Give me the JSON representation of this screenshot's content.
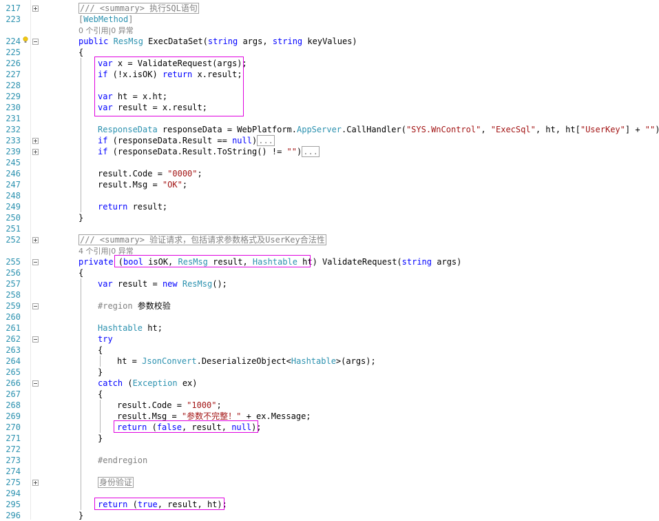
{
  "editor": {
    "lines": [
      {
        "n": "217",
        "indent": 0,
        "fold": "plus",
        "segs": [
          {
            "c": "cm boxed",
            "t": "/// <summary> 执行SQL语句"
          }
        ]
      },
      {
        "n": "223",
        "indent": 0,
        "segs": [
          {
            "c": "gray",
            "t": "["
          },
          {
            "c": "ty",
            "t": "WebMethod"
          },
          {
            "c": "gray",
            "t": "]"
          }
        ]
      },
      {
        "n": "",
        "indent": 0,
        "lens": true,
        "segs": [
          {
            "c": "codelens",
            "t": "0 个引用|0 异常"
          }
        ]
      },
      {
        "n": "224",
        "indent": 0,
        "fold": "minus",
        "bulb": true,
        "segs": [
          {
            "c": "kw",
            "t": "public"
          },
          {
            "t": " "
          },
          {
            "c": "ty",
            "t": "ResMsg"
          },
          {
            "t": " ExecDataSet("
          },
          {
            "c": "kw",
            "t": "string"
          },
          {
            "t": " args, "
          },
          {
            "c": "kw",
            "t": "string"
          },
          {
            "t": " keyValues)"
          }
        ]
      },
      {
        "n": "225",
        "indent": 0,
        "segs": [
          {
            "t": "{"
          }
        ]
      },
      {
        "n": "226",
        "indent": 1,
        "segs": [
          {
            "c": "kw",
            "t": "var"
          },
          {
            "t": " x = ValidateRequest(args);"
          }
        ]
      },
      {
        "n": "227",
        "indent": 1,
        "segs": [
          {
            "c": "kw",
            "t": "if"
          },
          {
            "t": " (!x.isOK) "
          },
          {
            "c": "kw",
            "t": "return"
          },
          {
            "t": " x.result;"
          }
        ]
      },
      {
        "n": "228",
        "indent": 1,
        "segs": []
      },
      {
        "n": "229",
        "indent": 1,
        "segs": [
          {
            "c": "kw",
            "t": "var"
          },
          {
            "t": " ht = x.ht;"
          }
        ]
      },
      {
        "n": "230",
        "indent": 1,
        "segs": [
          {
            "c": "kw",
            "t": "var"
          },
          {
            "t": " result = x.result;"
          }
        ]
      },
      {
        "n": "231",
        "indent": 1,
        "segs": []
      },
      {
        "n": "232",
        "indent": 1,
        "segs": [
          {
            "c": "ty",
            "t": "ResponseData"
          },
          {
            "t": " responseData = WebPlatform."
          },
          {
            "c": "ty",
            "t": "AppServer"
          },
          {
            "t": ".CallHandler("
          },
          {
            "c": "st",
            "t": "\"SYS.WnControl\""
          },
          {
            "t": ", "
          },
          {
            "c": "st",
            "t": "\"ExecSql\""
          },
          {
            "t": ", ht, ht["
          },
          {
            "c": "st",
            "t": "\"UserKey\""
          },
          {
            "t": "] + "
          },
          {
            "c": "st",
            "t": "\"\""
          },
          {
            "t": ");"
          }
        ]
      },
      {
        "n": "233",
        "indent": 1,
        "fold": "plus",
        "segs": [
          {
            "c": "kw",
            "t": "if"
          },
          {
            "t": " (responseData.Result == "
          },
          {
            "c": "kw",
            "t": "null"
          },
          {
            "t": ")"
          },
          {
            "c": "boxed gray",
            "t": "..."
          }
        ]
      },
      {
        "n": "239",
        "indent": 1,
        "fold": "plus",
        "segs": [
          {
            "c": "kw",
            "t": "if"
          },
          {
            "t": " (responseData.Result.ToString() != "
          },
          {
            "c": "st",
            "t": "\"\""
          },
          {
            "t": ")"
          },
          {
            "c": "boxed gray",
            "t": "..."
          }
        ]
      },
      {
        "n": "245",
        "indent": 1,
        "segs": []
      },
      {
        "n": "246",
        "indent": 1,
        "segs": [
          {
            "t": "result.Code = "
          },
          {
            "c": "st",
            "t": "\"0000\""
          },
          {
            "t": ";"
          }
        ]
      },
      {
        "n": "247",
        "indent": 1,
        "segs": [
          {
            "t": "result.Msg = "
          },
          {
            "c": "st",
            "t": "\"OK\""
          },
          {
            "t": ";"
          }
        ]
      },
      {
        "n": "248",
        "indent": 1,
        "segs": []
      },
      {
        "n": "249",
        "indent": 1,
        "segs": [
          {
            "c": "kw",
            "t": "return"
          },
          {
            "t": " result;"
          }
        ]
      },
      {
        "n": "250",
        "indent": 0,
        "segs": [
          {
            "t": "}"
          }
        ]
      },
      {
        "n": "251",
        "indent": 0,
        "segs": []
      },
      {
        "n": "252",
        "indent": 0,
        "fold": "plus",
        "segs": [
          {
            "c": "cm boxed",
            "t": "/// <summary> 验证请求，包括请求参数格式及UserKey合法性"
          }
        ]
      },
      {
        "n": "",
        "indent": 0,
        "lens": true,
        "segs": [
          {
            "c": "codelens",
            "t": "4 个引用|0 异常"
          }
        ]
      },
      {
        "n": "255",
        "indent": 0,
        "fold": "minus",
        "segs": [
          {
            "c": "kw",
            "t": "private"
          },
          {
            "t": " ("
          },
          {
            "c": "kw",
            "t": "bool"
          },
          {
            "t": " isOK, "
          },
          {
            "c": "ty",
            "t": "ResMsg"
          },
          {
            "t": " result, "
          },
          {
            "c": "ty",
            "t": "Hashtable"
          },
          {
            "t": " ht) ValidateRequest("
          },
          {
            "c": "kw",
            "t": "string"
          },
          {
            "t": " args)"
          }
        ]
      },
      {
        "n": "256",
        "indent": 0,
        "segs": [
          {
            "t": "{"
          }
        ]
      },
      {
        "n": "257",
        "indent": 1,
        "segs": [
          {
            "c": "kw",
            "t": "var"
          },
          {
            "t": " result = "
          },
          {
            "c": "kw",
            "t": "new"
          },
          {
            "t": " "
          },
          {
            "c": "ty",
            "t": "ResMsg"
          },
          {
            "t": "();"
          }
        ]
      },
      {
        "n": "258",
        "indent": 1,
        "segs": []
      },
      {
        "n": "259",
        "indent": 1,
        "fold": "minus",
        "segs": [
          {
            "c": "gray",
            "t": "#region"
          },
          {
            "t": " 参数校验"
          }
        ]
      },
      {
        "n": "260",
        "indent": 1,
        "segs": []
      },
      {
        "n": "261",
        "indent": 1,
        "segs": [
          {
            "c": "ty",
            "t": "Hashtable"
          },
          {
            "t": " ht;"
          }
        ]
      },
      {
        "n": "262",
        "indent": 1,
        "fold": "minus",
        "segs": [
          {
            "c": "kw",
            "t": "try"
          }
        ]
      },
      {
        "n": "263",
        "indent": 1,
        "segs": [
          {
            "t": "{"
          }
        ]
      },
      {
        "n": "264",
        "indent": 2,
        "segs": [
          {
            "t": "ht = "
          },
          {
            "c": "ty",
            "t": "JsonConvert"
          },
          {
            "t": ".DeserializeObject<"
          },
          {
            "c": "ty",
            "t": "Hashtable"
          },
          {
            "t": ">(args);"
          }
        ]
      },
      {
        "n": "265",
        "indent": 1,
        "segs": [
          {
            "t": "}"
          }
        ]
      },
      {
        "n": "266",
        "indent": 1,
        "fold": "minus",
        "segs": [
          {
            "c": "kw",
            "t": "catch"
          },
          {
            "t": " ("
          },
          {
            "c": "ty",
            "t": "Exception"
          },
          {
            "t": " ex)"
          }
        ]
      },
      {
        "n": "267",
        "indent": 1,
        "segs": [
          {
            "t": "{"
          }
        ]
      },
      {
        "n": "268",
        "indent": 2,
        "segs": [
          {
            "t": "result.Code = "
          },
          {
            "c": "st",
            "t": "\"1000\""
          },
          {
            "t": ";"
          }
        ]
      },
      {
        "n": "269",
        "indent": 2,
        "segs": [
          {
            "t": "result.Msg = "
          },
          {
            "c": "st",
            "t": "\"参数不完整！\""
          },
          {
            "t": " + ex.Message;"
          }
        ]
      },
      {
        "n": "270",
        "indent": 2,
        "segs": [
          {
            "c": "kw",
            "t": "return"
          },
          {
            "t": " ("
          },
          {
            "c": "kw",
            "t": "false"
          },
          {
            "t": ", result, "
          },
          {
            "c": "kw",
            "t": "null"
          },
          {
            "t": ");"
          }
        ]
      },
      {
        "n": "271",
        "indent": 1,
        "segs": [
          {
            "t": "}"
          }
        ]
      },
      {
        "n": "272",
        "indent": 1,
        "segs": []
      },
      {
        "n": "273",
        "indent": 1,
        "segs": [
          {
            "c": "gray",
            "t": "#endregion"
          }
        ]
      },
      {
        "n": "274",
        "indent": 1,
        "segs": []
      },
      {
        "n": "275",
        "indent": 1,
        "fold": "plus",
        "segs": [
          {
            "c": "gray boxed",
            "t": "身份验证"
          }
        ]
      },
      {
        "n": "294",
        "indent": 1,
        "segs": []
      },
      {
        "n": "295",
        "indent": 1,
        "segs": [
          {
            "c": "kw",
            "t": "return"
          },
          {
            "t": " ("
          },
          {
            "c": "kw",
            "t": "true"
          },
          {
            "t": ", result, ht);"
          }
        ]
      },
      {
        "n": "296",
        "indent": 0,
        "segs": [
          {
            "t": "}"
          }
        ]
      }
    ]
  },
  "annotation_color": "#e000e0"
}
